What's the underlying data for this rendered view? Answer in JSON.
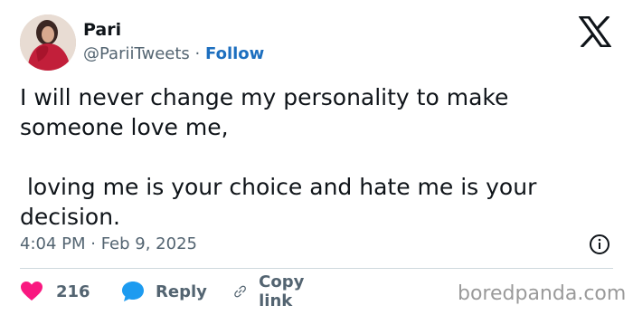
{
  "author": {
    "name": "Pari",
    "handle": "@PariiTweets",
    "separator": "·",
    "follow_label": "Follow"
  },
  "tweet": {
    "text": "I will never change my personality to make someone love me,\n\n loving me is your choice and hate me is your decision.",
    "timestamp": "4:04 PM · Feb 9, 2025"
  },
  "actions": {
    "like_count": "216",
    "reply_label": "Reply",
    "copy_link_label": "Copy link"
  },
  "watermark": "boredpanda.com",
  "colors": {
    "like": "#f91880",
    "reply": "#1d9bf0",
    "follow": "#1d6fbf"
  },
  "icons": [
    "x-logo-icon",
    "info-icon",
    "heart-icon",
    "reply-bubble-icon",
    "link-icon"
  ]
}
